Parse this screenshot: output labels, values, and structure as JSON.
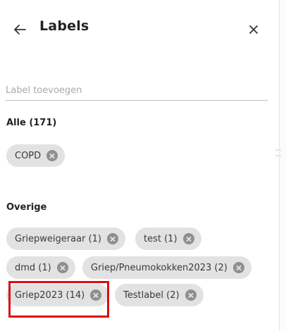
{
  "header": {
    "title": "Labels"
  },
  "input": {
    "placeholder": "Label toevoegen",
    "value": ""
  },
  "sections": {
    "alle": {
      "title": "Alle (171)",
      "chips": [
        "COPD"
      ]
    },
    "overige": {
      "title": "Overige",
      "chips": [
        "Griepweigeraar (1)",
        "test (1)",
        "dmd (1)",
        "Griep/Pneumokokken2023 (2)",
        "Griep2023 (14)",
        "Testlabel (2)"
      ]
    }
  },
  "icons": {
    "back": "arrow-left-icon",
    "close": "close-icon",
    "chip_remove": "x-circle-icon"
  },
  "colors": {
    "chip_bg": "#e2e2e2",
    "chip_remove": "#8f8f8f",
    "highlight": "#d90f0f",
    "divider": "#bdbdbd"
  }
}
